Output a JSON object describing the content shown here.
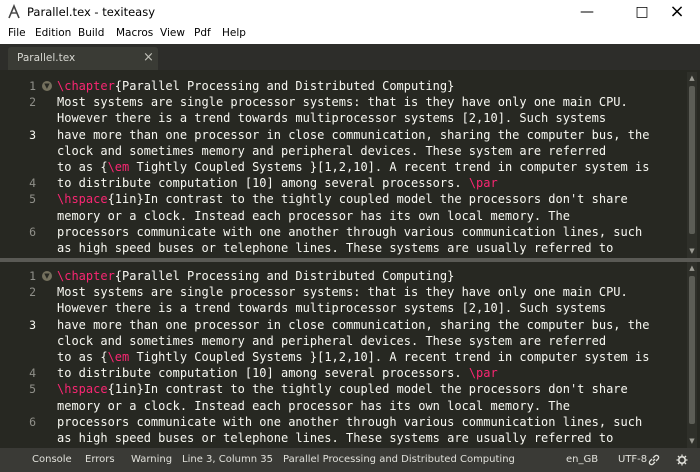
{
  "window": {
    "title": "Parallel.tex - texiteasy"
  },
  "menu": [
    "File",
    "Edition",
    "Build",
    "Macros",
    "View",
    "Pdf",
    "Help"
  ],
  "tab": {
    "label": "Parallel.tex",
    "close": "×"
  },
  "editor": {
    "lines": [
      {
        "num": "1",
        "segments": [
          [
            "k",
            "\\chapter"
          ],
          [
            "t",
            "{Parallel Processing and Distributed Computing}"
          ]
        ]
      },
      {
        "num": "2",
        "segments": [
          [
            "t",
            "Most systems are single processor systems: that is they have only one main CPU."
          ]
        ]
      },
      {
        "num": "",
        "segments": [
          [
            "t",
            "However there is a trend towards multiprocessor systems [2,10]. Such systems"
          ]
        ]
      },
      {
        "num": "3",
        "segments": [
          [
            "t",
            "have more than one processor in close communication, sharing the computer bus, the"
          ]
        ]
      },
      {
        "num": "",
        "segments": [
          [
            "t",
            "clock and sometimes memory and peripheral devices. These system are referred"
          ]
        ]
      },
      {
        "num": "",
        "segments": [
          [
            "t",
            "to as {"
          ],
          [
            "k",
            "\\em"
          ],
          [
            "t",
            " Tightly Coupled Systems }[1,2,10]. A recent trend in computer system is"
          ]
        ]
      },
      {
        "num": "4",
        "segments": [
          [
            "t",
            "to distribute computation [10] among several processors. "
          ],
          [
            "k",
            "\\par"
          ]
        ]
      },
      {
        "num": "5",
        "segments": [
          [
            "k",
            "\\hspace"
          ],
          [
            "t",
            "{1in}In contrast to the tightly coupled model the processors don't share"
          ]
        ]
      },
      {
        "num": "",
        "segments": [
          [
            "t",
            "memory or a clock. Instead each processor has its own local memory. The"
          ]
        ]
      },
      {
        "num": "6",
        "segments": [
          [
            "t",
            "processors communicate with one another through various communication lines, such"
          ]
        ]
      },
      {
        "num": "",
        "segments": [
          [
            "t",
            "as high speed buses or telephone lines. These systems are usually referred to"
          ]
        ]
      }
    ],
    "current_line": "3"
  },
  "status": {
    "console": "Console",
    "errors": "Errors",
    "warning": "Warning",
    "position": "Line 3, Column 35",
    "section": "Parallel Processing and Distributed Computing",
    "language": "en_GB",
    "encoding": "UTF-8"
  },
  "colors": {
    "background": "#272822",
    "keyword": "#f92672",
    "text": "#f8f8f2",
    "gutter": "#90908a"
  },
  "icons": [
    "app-icon",
    "minimize-icon",
    "maximize-icon",
    "close-icon",
    "fold-icon",
    "link-icon",
    "gear-icon"
  ]
}
